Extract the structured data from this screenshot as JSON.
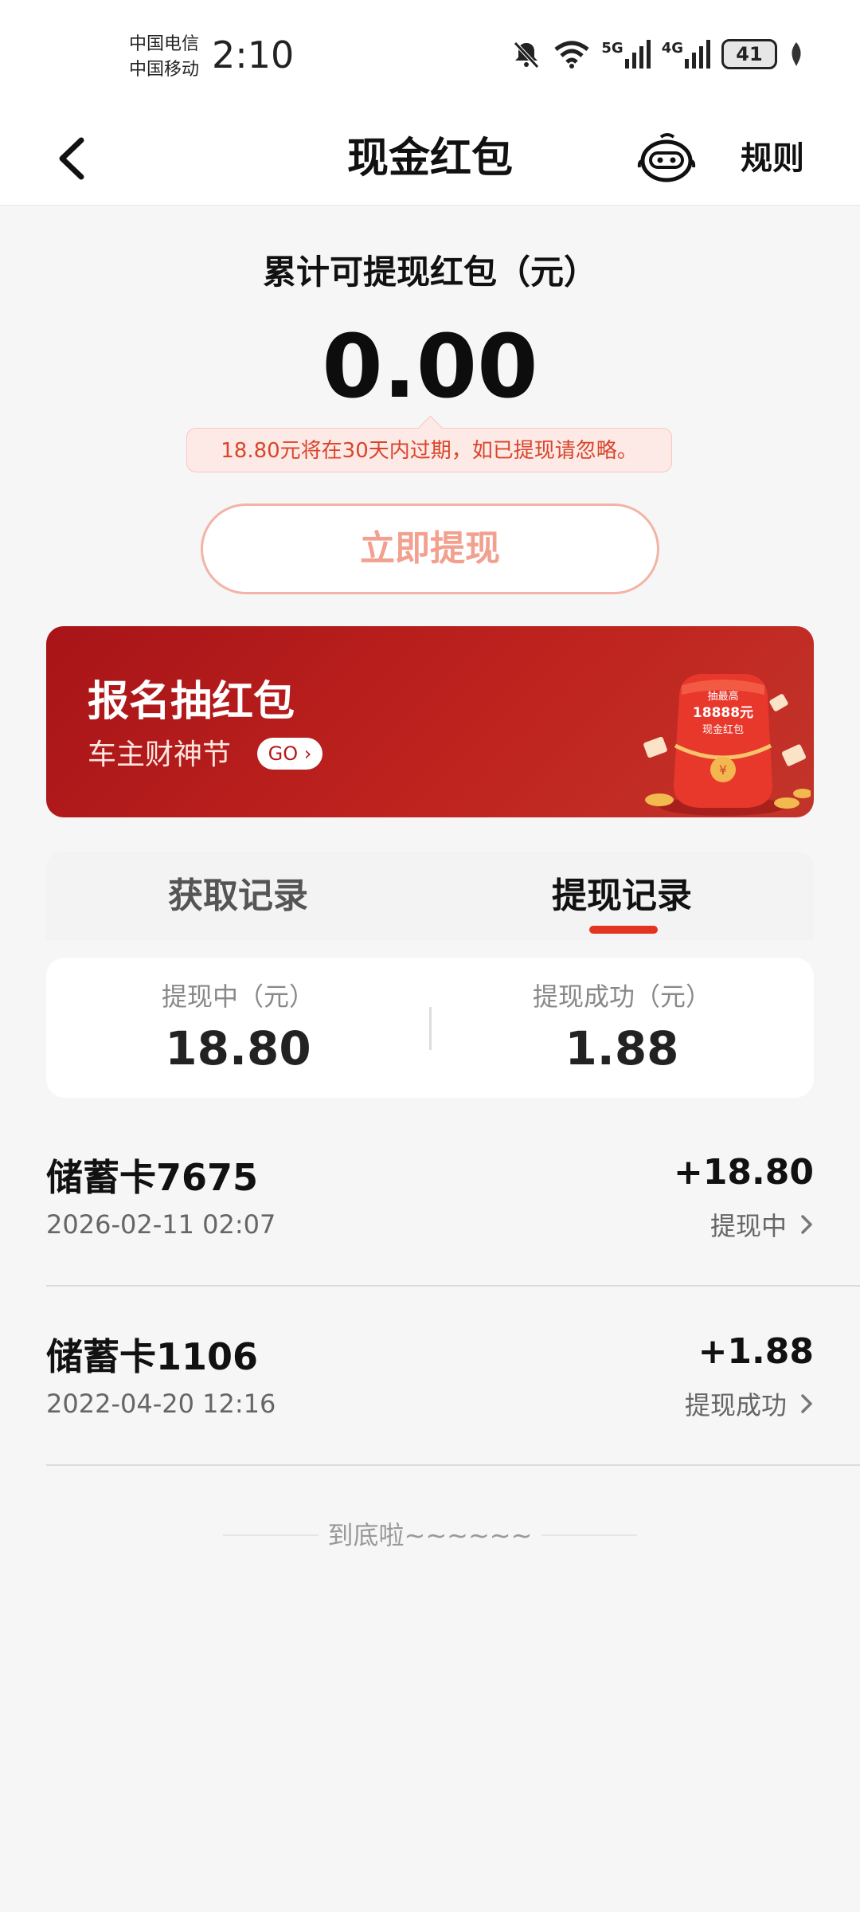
{
  "status_bar": {
    "carrier_1": "中国电信",
    "carrier_2": "中国移动",
    "time": "2:10",
    "net_5g": "5G",
    "net_4g": "4G",
    "battery": "41"
  },
  "nav": {
    "title": "现金红包",
    "rules": "规则"
  },
  "balance": {
    "label": "累计可提现红包（元）",
    "amount": "0.00",
    "notice": "18.80元将在30天内过期，如已提现请忽略。",
    "withdraw_button": "立即提现"
  },
  "banner": {
    "title": "报名抽红包",
    "subtitle": "车主财神节",
    "go": "GO",
    "art_line1": "抽最高",
    "art_line2": "18888元",
    "art_line3": "现金红包"
  },
  "tabs": {
    "obtain": "获取记录",
    "withdraw": "提现记录"
  },
  "summary": {
    "pending_label": "提现中（元）",
    "pending_value": "18.80",
    "success_label": "提现成功（元）",
    "success_value": "1.88"
  },
  "records": [
    {
      "card": "储蓄卡7675",
      "date": "2026-02-11 02:07",
      "amount": "+18.80",
      "status": "提现中"
    },
    {
      "card": "储蓄卡1106",
      "date": "2022-04-20 12:16",
      "amount": "+1.88",
      "status": "提现成功"
    }
  ],
  "footer": {
    "end_text": "到底啦~~~~~~"
  },
  "colors": {
    "accent_red": "#e3341f",
    "banner_red": "#b3191b",
    "notice_text": "#d9452b"
  }
}
